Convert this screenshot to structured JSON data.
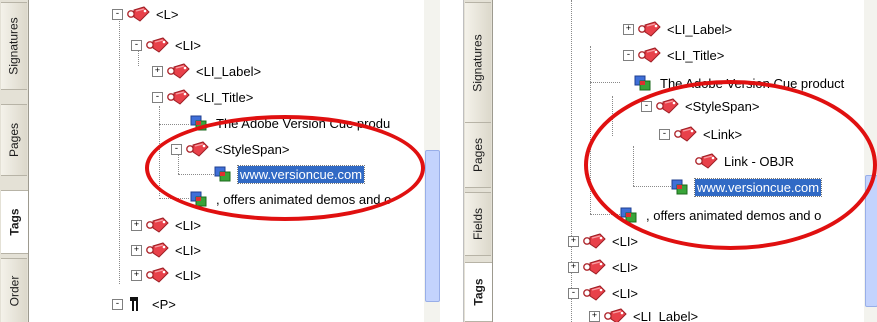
{
  "left_panel": {
    "tabs": [
      "Signatures",
      "Pages",
      "Tags",
      "Order"
    ],
    "active_tab": "Tags",
    "nodes": [
      {
        "label": "<L>",
        "expander": "-"
      },
      {
        "label": "<LI>",
        "expander": "-"
      },
      {
        "label": "<LI_Label>",
        "expander": "+"
      },
      {
        "label": "<LI_Title>",
        "expander": "-"
      },
      {
        "label": "The Adobe Version Cue produ"
      },
      {
        "label": "<StyleSpan>",
        "expander": "-"
      },
      {
        "label": "www.versioncue.com"
      },
      {
        "label": ", offers animated demos and o"
      },
      {
        "label": "<LI>",
        "expander": "+"
      },
      {
        "label": "<LI>",
        "expander": "+"
      },
      {
        "label": "<LI>",
        "expander": "+"
      },
      {
        "label": "<P>",
        "expander": "-"
      }
    ]
  },
  "right_panel": {
    "tabs": [
      "Signatures",
      "Pages",
      "Fields",
      "Tags"
    ],
    "active_tab": "Tags",
    "nodes": [
      {
        "label": "<LI_Label>",
        "expander": "+"
      },
      {
        "label": "<LI_Title>",
        "expander": "-"
      },
      {
        "label": "The Adobe Version Cue product"
      },
      {
        "label": "<StyleSpan>",
        "expander": "-"
      },
      {
        "label": "<Link>",
        "expander": "-"
      },
      {
        "label": "Link - OBJR"
      },
      {
        "label": "www.versioncue.com"
      },
      {
        "label": ", offers animated demos and o"
      },
      {
        "label": "<LI>",
        "expander": "+"
      },
      {
        "label": "<LI>",
        "expander": "+"
      },
      {
        "label": "<LI>",
        "expander": "-"
      },
      {
        "label": "<LI_Label>",
        "expander": "+"
      }
    ]
  },
  "colors": {
    "selection": "#316ac5",
    "annotation_circle": "#e01010",
    "tag_icon": "#e8414a"
  },
  "icons": {
    "tag": "tag-icon",
    "content": "content-icon",
    "paragraph": "paragraph-icon"
  }
}
